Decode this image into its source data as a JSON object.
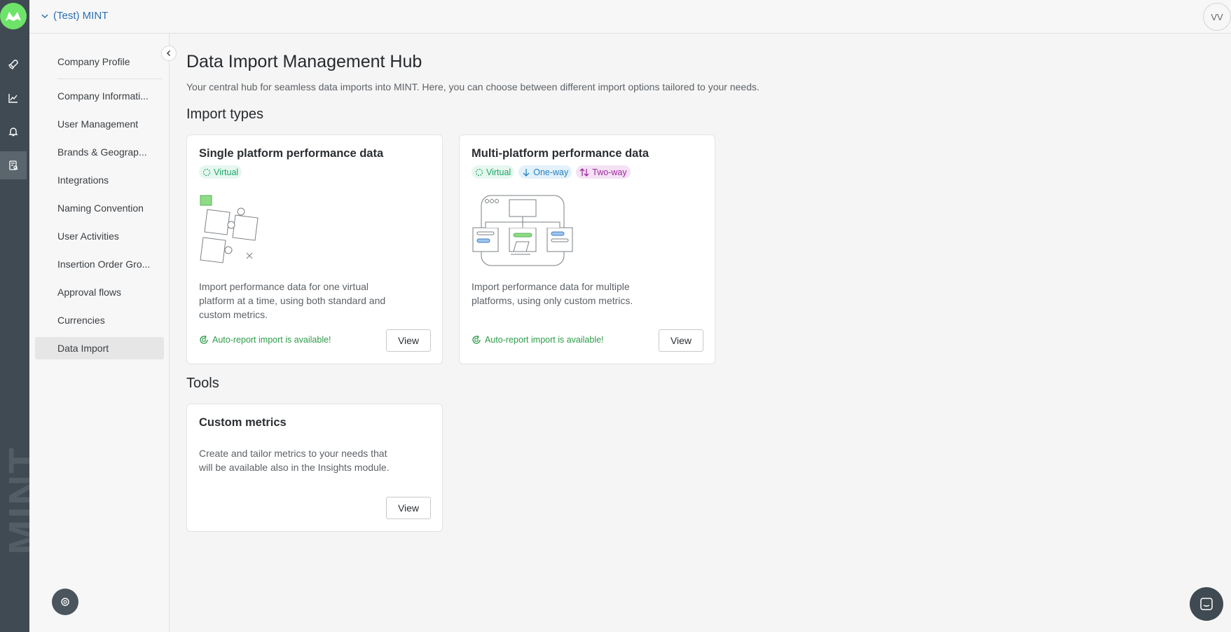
{
  "topbar": {
    "org_name": "(Test) MINT",
    "avatar_initials": "VV"
  },
  "rail": {
    "brand_text": "MINT",
    "items": [
      "rocket-icon",
      "chart-line-icon",
      "bell-icon",
      "data-import-icon"
    ]
  },
  "sidebar": {
    "items": [
      {
        "label": "Company Profile"
      },
      {
        "label": "Company Informati..."
      },
      {
        "label": "User Management"
      },
      {
        "label": "Brands & Geograp..."
      },
      {
        "label": "Integrations"
      },
      {
        "label": "Naming Convention"
      },
      {
        "label": "User Activities"
      },
      {
        "label": "Insertion Order Gro..."
      },
      {
        "label": "Approval flows"
      },
      {
        "label": "Currencies"
      },
      {
        "label": "Data Import"
      }
    ],
    "active_item": "Data Import"
  },
  "main": {
    "title": "Data Import Management Hub",
    "description": "Your central hub for seamless data imports into MINT. Here, you can choose between different import options tailored to your needs.",
    "import_types_heading": "Import types",
    "tools_heading": "Tools",
    "cards": [
      {
        "title": "Single platform performance data",
        "chips": [
          "Virtual"
        ],
        "description": "Import performance data for one virtual platform at a time, using both standard and custom metrics.",
        "auto_report": "Auto-report import is available!",
        "button": "View"
      },
      {
        "title": "Multi-platform performance data",
        "chips": [
          "Virtual",
          "One-way",
          "Two-way"
        ],
        "description": "Import performance data for multiple platforms, using only custom metrics.",
        "auto_report": "Auto-report import is available!",
        "button": "View"
      }
    ],
    "tools": [
      {
        "title": "Custom metrics",
        "description": "Create and tailor metrics to your needs that will be available also in the Insights module.",
        "button": "View"
      }
    ]
  },
  "colors": {
    "rail_bg": "#3f4a52",
    "logo_green": "#6ee36a",
    "link_blue": "#2d6fb3",
    "success_green": "#2e9b48",
    "chip_virtual": "#1ea56a",
    "chip_oneway": "#2480bf",
    "chip_twoway": "#9e2a9e"
  }
}
